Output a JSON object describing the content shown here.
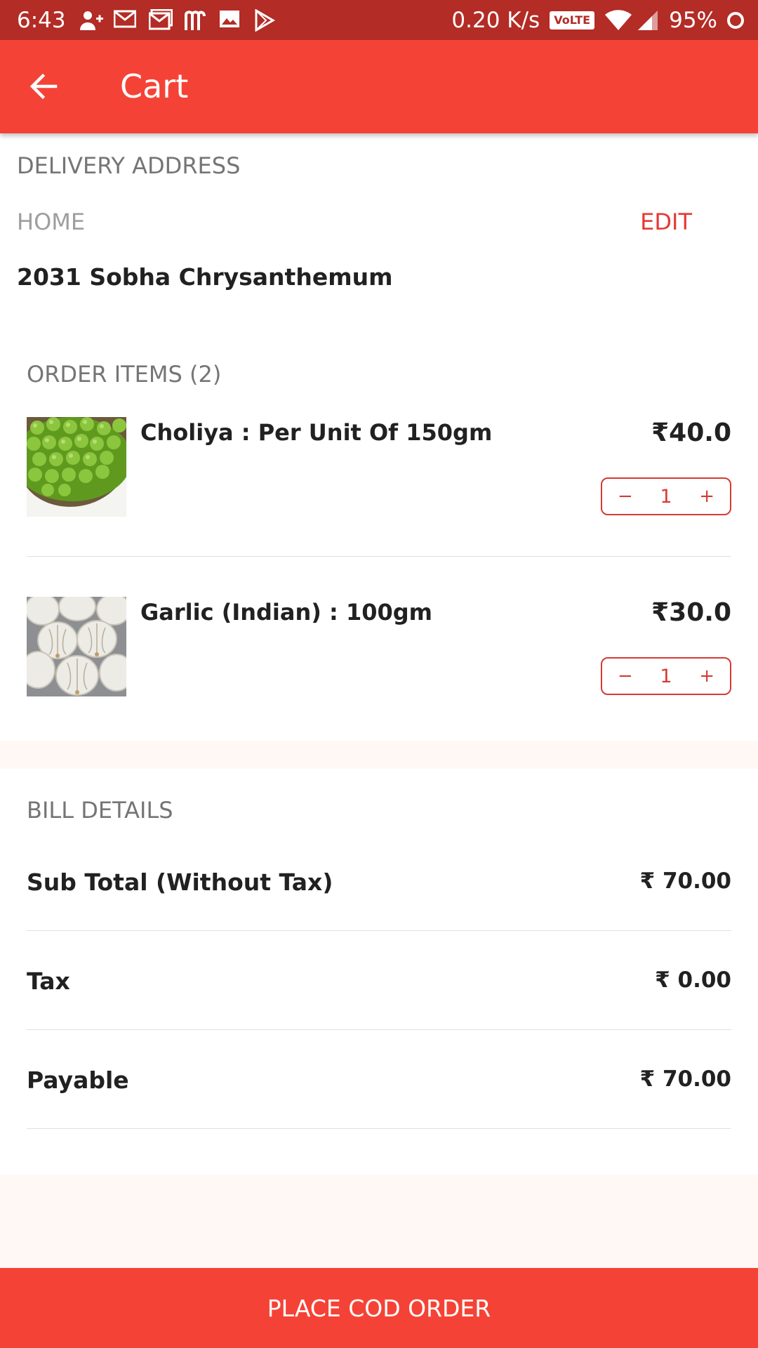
{
  "status_bar": {
    "time": "6:43",
    "network_speed": "0.20 K/s",
    "volte": "VoLTE",
    "battery": "95%",
    "icons": [
      "person-add-icon",
      "gmail-icon",
      "gmail-icon",
      "m-app-icon",
      "image-icon",
      "play-store-icon",
      "wifi-icon",
      "signal-icon",
      "battery-icon"
    ]
  },
  "app_bar": {
    "title": "Cart",
    "back_icon": "arrow-left-icon",
    "color": "#f44336"
  },
  "delivery": {
    "header": "DELIVERY ADDRESS",
    "address_type": "HOME",
    "edit_label": "EDIT",
    "address": "2031 Sobha Chrysanthemum"
  },
  "order": {
    "header": "ORDER ITEMS (2)",
    "items": [
      {
        "name": "Choliya : Per Unit Of 150gm",
        "price": "₹40.0",
        "quantity": "1",
        "minus": "−",
        "plus": "+"
      },
      {
        "name": "Garlic (Indian) : 100gm",
        "price": "₹30.0",
        "quantity": "1",
        "minus": "−",
        "plus": "+"
      }
    ]
  },
  "bill": {
    "header": "BILL DETAILS",
    "rows": [
      {
        "label": "Sub Total (Without Tax)",
        "value": "₹ 70.00"
      },
      {
        "label": "Tax",
        "value": "₹ 0.00"
      },
      {
        "label": "Payable",
        "value": "₹ 70.00"
      }
    ]
  },
  "cta": {
    "label": "PLACE COD ORDER"
  },
  "colors": {
    "primary": "#f44336",
    "status_bar": "#b32c25",
    "accent_text": "#e53935"
  }
}
